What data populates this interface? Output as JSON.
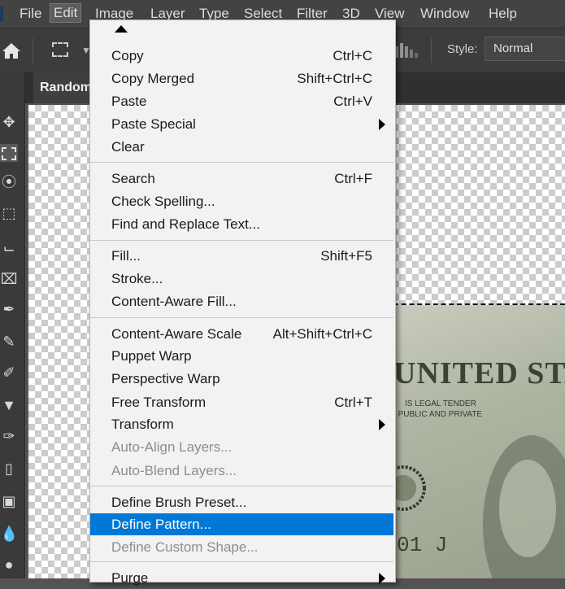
{
  "menubar": {
    "items": [
      {
        "label": "File",
        "active": false
      },
      {
        "label": "Edit",
        "active": true
      },
      {
        "label": "Image",
        "active": false
      },
      {
        "label": "Layer",
        "active": false
      },
      {
        "label": "Type",
        "active": false
      },
      {
        "label": "Select",
        "active": false
      },
      {
        "label": "Filter",
        "active": false
      },
      {
        "label": "3D",
        "active": false
      },
      {
        "label": "View",
        "active": false
      },
      {
        "label": "Window",
        "active": false
      },
      {
        "label": "Help",
        "active": false
      }
    ]
  },
  "options_bar": {
    "home_icon": "home-icon",
    "marquee_icon": "rectangular-marquee-icon",
    "style_label": "Style:",
    "style_value": "Normal"
  },
  "document": {
    "tab_title": "Random",
    "bill_text": {
      "country": "UNITED STA",
      "tender_line1": "IS LEGAL TENDER",
      "tender_line2": ", PUBLIC AND PRIVATE",
      "serial": "01 J"
    }
  },
  "toolbar": {
    "tools": [
      "move-icon",
      "marquee-icon",
      "lasso-icon",
      "object-select-icon",
      "crop-icon",
      "frame-icon",
      "eyedropper-icon",
      "healing-brush-icon",
      "brush-icon",
      "clone-stamp-icon",
      "history-brush-icon",
      "eraser-icon",
      "gradient-icon",
      "blur-icon",
      "dodge-icon"
    ]
  },
  "edit_menu": {
    "items": [
      {
        "label": "Copy",
        "shortcut": "Ctrl+C",
        "submenu": false,
        "disabled": false,
        "highlighted": false
      },
      {
        "label": "Copy Merged",
        "shortcut": "Shift+Ctrl+C",
        "submenu": false,
        "disabled": false,
        "highlighted": false
      },
      {
        "label": "Paste",
        "shortcut": "Ctrl+V",
        "submenu": false,
        "disabled": false,
        "highlighted": false
      },
      {
        "label": "Paste Special",
        "shortcut": "",
        "submenu": true,
        "disabled": false,
        "highlighted": false
      },
      {
        "label": "Clear",
        "shortcut": "",
        "submenu": false,
        "disabled": false,
        "highlighted": false
      },
      {
        "label": "Search",
        "shortcut": "Ctrl+F",
        "submenu": false,
        "disabled": false,
        "highlighted": false
      },
      {
        "label": "Check Spelling...",
        "shortcut": "",
        "submenu": false,
        "disabled": false,
        "highlighted": false
      },
      {
        "label": "Find and Replace Text...",
        "shortcut": "",
        "submenu": false,
        "disabled": false,
        "highlighted": false
      },
      {
        "label": "Fill...",
        "shortcut": "Shift+F5",
        "submenu": false,
        "disabled": false,
        "highlighted": false
      },
      {
        "label": "Stroke...",
        "shortcut": "",
        "submenu": false,
        "disabled": false,
        "highlighted": false
      },
      {
        "label": "Content-Aware Fill...",
        "shortcut": "",
        "submenu": false,
        "disabled": false,
        "highlighted": false
      },
      {
        "label": "Content-Aware Scale",
        "shortcut": "Alt+Shift+Ctrl+C",
        "submenu": false,
        "disabled": false,
        "highlighted": false
      },
      {
        "label": "Puppet Warp",
        "shortcut": "",
        "submenu": false,
        "disabled": false,
        "highlighted": false
      },
      {
        "label": "Perspective Warp",
        "shortcut": "",
        "submenu": false,
        "disabled": false,
        "highlighted": false
      },
      {
        "label": "Free Transform",
        "shortcut": "Ctrl+T",
        "submenu": false,
        "disabled": false,
        "highlighted": false
      },
      {
        "label": "Transform",
        "shortcut": "",
        "submenu": true,
        "disabled": false,
        "highlighted": false
      },
      {
        "label": "Auto-Align Layers...",
        "shortcut": "",
        "submenu": false,
        "disabled": true,
        "highlighted": false
      },
      {
        "label": "Auto-Blend Layers...",
        "shortcut": "",
        "submenu": false,
        "disabled": true,
        "highlighted": false
      },
      {
        "label": "Define Brush Preset...",
        "shortcut": "",
        "submenu": false,
        "disabled": false,
        "highlighted": false
      },
      {
        "label": "Define Pattern...",
        "shortcut": "",
        "submenu": false,
        "disabled": false,
        "highlighted": true
      },
      {
        "label": "Define Custom Shape...",
        "shortcut": "",
        "submenu": false,
        "disabled": true,
        "highlighted": false
      },
      {
        "label": "Purge",
        "shortcut": "",
        "submenu": true,
        "disabled": false,
        "highlighted": false
      }
    ]
  },
  "colors": {
    "highlight": "#0078d7",
    "menu_bg": "#f2f2f2",
    "app_bg": "#535353"
  }
}
